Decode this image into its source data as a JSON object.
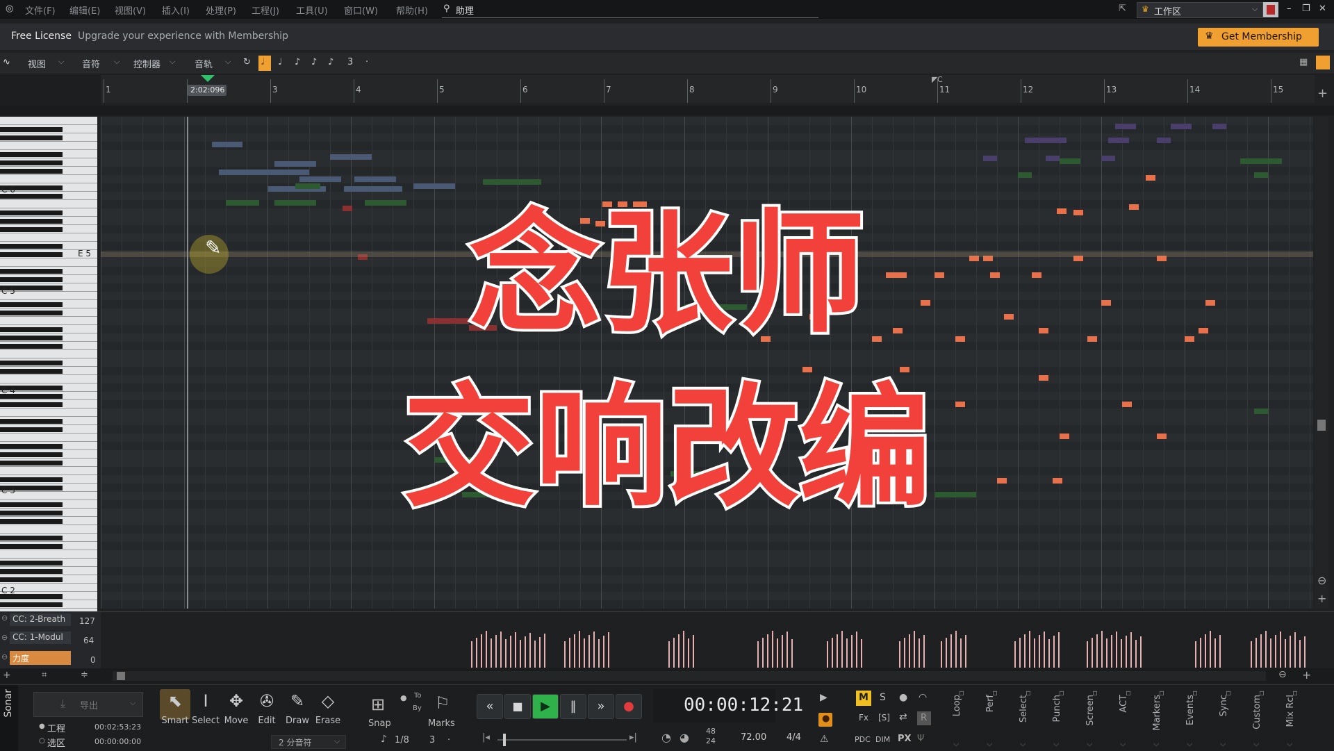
{
  "menubar": {
    "items": [
      "文件(F)",
      "编辑(E)",
      "视图(V)",
      "插入(I)",
      "处理(P)",
      "工程(J)",
      "工具(U)",
      "窗口(W)",
      "帮助(H)"
    ],
    "assistant": "助理",
    "workspace": "工作区"
  },
  "license": {
    "label": "Free License",
    "message": "Upgrade your experience with Membership",
    "cta": "Get Membership"
  },
  "toolbar": {
    "view": "视图",
    "notes": "音符",
    "controller": "控制器",
    "track": "音轨",
    "triplet": "3"
  },
  "ruler": {
    "bars": [
      "1",
      "2",
      "3",
      "4",
      "5",
      "6",
      "7",
      "8",
      "9",
      "10",
      "11",
      "12",
      "13",
      "14",
      "15"
    ],
    "now_time": "2:02:096",
    "marker": "C"
  },
  "piano": {
    "labels": [
      "C 6",
      "E 5",
      "C 5",
      "C 4",
      "C 3",
      "C 2"
    ]
  },
  "title": {
    "line1": "念张师",
    "line2": "交响改编"
  },
  "cc": {
    "lanes": [
      "CC: 2-Breath",
      "CC: 1-Modul",
      "力度"
    ],
    "values": [
      "127",
      "64",
      "0"
    ]
  },
  "tools": [
    {
      "label": "Smart",
      "icon": "smart-arrow-icon"
    },
    {
      "label": "Select",
      "icon": "i-beam-icon"
    },
    {
      "label": "Move",
      "icon": "move-cross-icon"
    },
    {
      "label": "Edit",
      "icon": "wrench-icon"
    },
    {
      "label": "Draw",
      "icon": "pencil-icon"
    },
    {
      "label": "Erase",
      "icon": "eraser-icon"
    }
  ],
  "export": {
    "label": "导出",
    "project": "工程",
    "project_time": "00:02:53:23",
    "selection": "选区",
    "selection_time": "00:00:00:00",
    "division": "2 分音符"
  },
  "snap": {
    "label": "Snap",
    "to": "To",
    "by": "By",
    "marks": "Marks",
    "value": "1/8",
    "triplet": "3"
  },
  "transport": {
    "time": "00:00:12:21",
    "tempo": "72.00",
    "meter": "4/4",
    "sample_top": "48",
    "sample_bottom": "24"
  },
  "mix": {
    "m": "M",
    "s": "S",
    "fx": "Fx",
    "pdc": "PDC",
    "dim": "DIM",
    "px": "PX"
  },
  "modules": [
    "Loop",
    "Perf",
    "Select",
    "Punch",
    "Screen",
    "ACT",
    "Markers",
    "Events",
    "Sync",
    "Custom",
    "Mix Rcl"
  ],
  "app": {
    "name": "Sonar"
  },
  "colors": {
    "accent": "#f0a030",
    "title_red": "#f2403a",
    "note_orange": "#e8704a"
  }
}
